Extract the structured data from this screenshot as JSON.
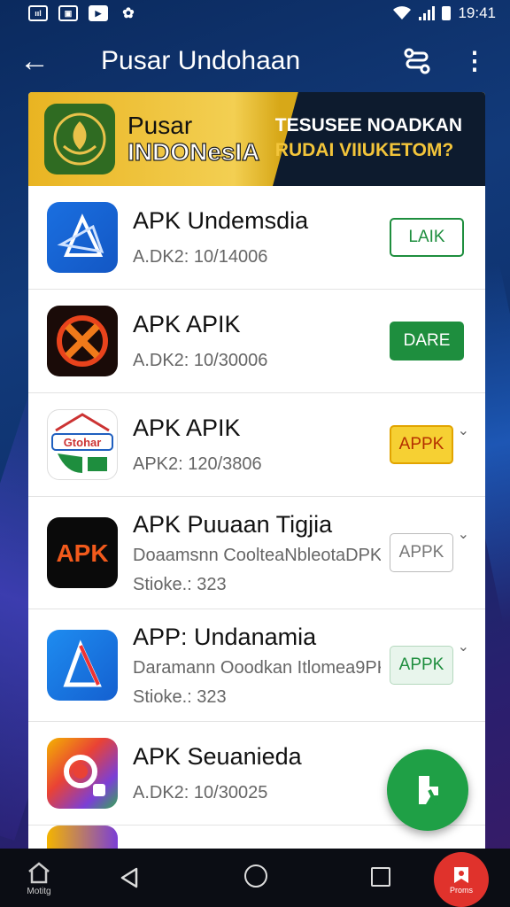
{
  "status_bar": {
    "icons": [
      "sim-icon",
      "gallery-icon",
      "youtube-icon",
      "gift-icon"
    ],
    "time": "19:41"
  },
  "app_bar": {
    "title": "Pusar Undohaan"
  },
  "banner": {
    "title_line1": "Pusar",
    "title_line2": "INDONesIA",
    "promo_line1": "TESUSEE NOADKAN",
    "promo_line2": "RUDAI VIIUKETOM?"
  },
  "apps": [
    {
      "name": "APK Undemsdia",
      "sub": "A.DK2: 10/14006",
      "button": "LAIK",
      "style": "outline-green",
      "icon": "triangle-logo-icon"
    },
    {
      "name": "APK APIK",
      "sub": "A.DK2: 10/30006",
      "button": "DARE",
      "style": "green",
      "icon": "x-logo-icon"
    },
    {
      "name": "APK APIK",
      "sub": "APK2: 120/3806",
      "button": "APPK",
      "style": "yellow",
      "icon": "gtohar-logo-icon"
    },
    {
      "name": "APK Puuaan Tigjia",
      "desc": "Doaamsnn CoolteaNbleotaDPK",
      "sub": "Stioke.: 323",
      "button": "APPK",
      "style": "grey",
      "icon": "apk-logo-icon"
    },
    {
      "name": "APP: Undanamia",
      "desc": "Daramann Ooodkan Itlomea9PK",
      "sub": "Stioke.: 323",
      "button": "APPK",
      "style": "lightgreen",
      "icon": "triangle-logo-icon"
    },
    {
      "name": "APK Seuanieda",
      "sub": "A.DK2: 10/30025",
      "button": "",
      "style": "none",
      "icon": "chrome-like-icon"
    }
  ],
  "nav": {
    "home_label": "Motitg",
    "right_label": "Proms"
  },
  "colors": {
    "primary_green": "#1e8e3e",
    "banner_gold": "#e9b422",
    "nav_red": "#e0322c"
  }
}
